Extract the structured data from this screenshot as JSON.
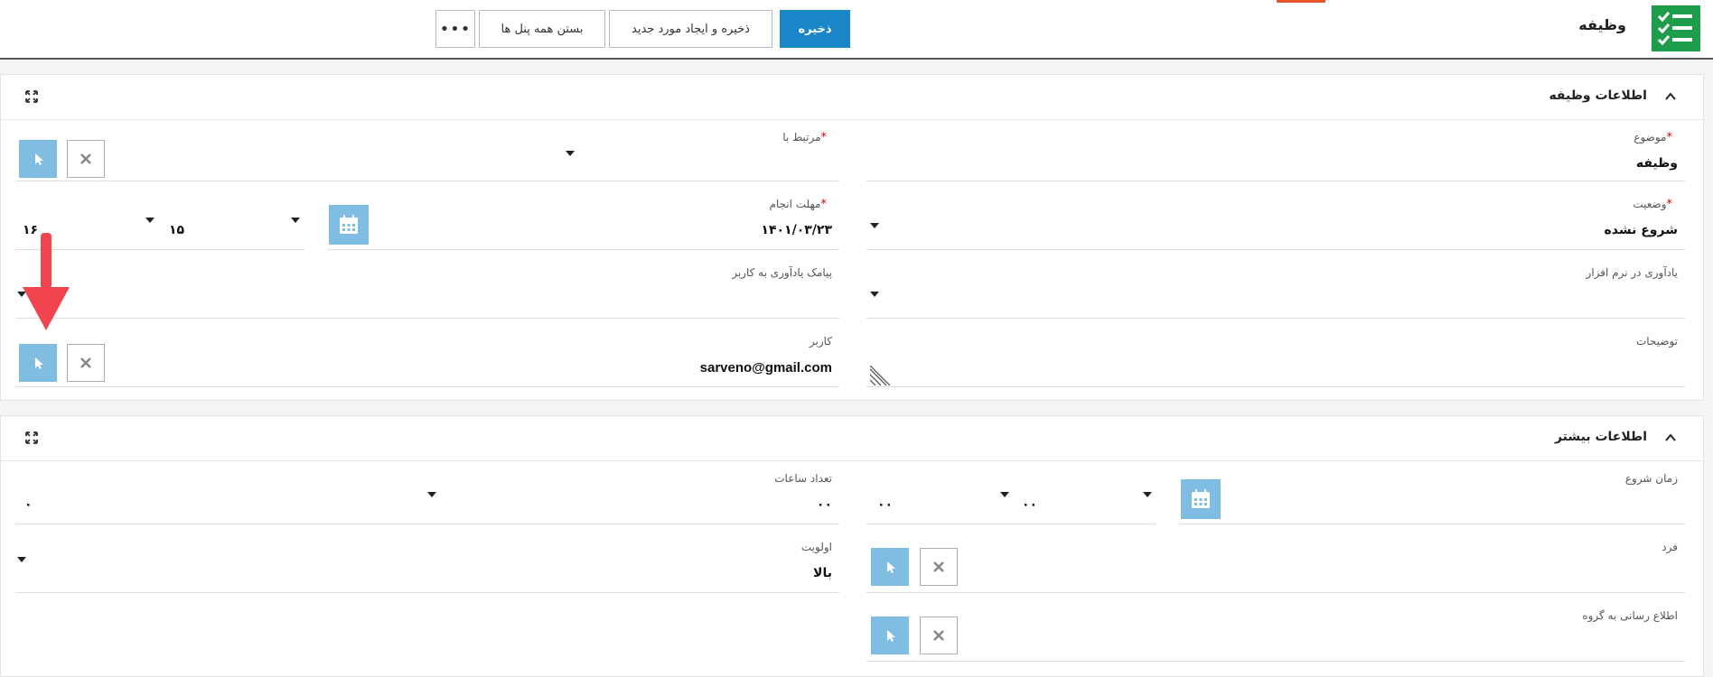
{
  "header": {
    "title": "وظیفه",
    "save_label": "ذخیره",
    "save_new_label": "ذخیره و ایجاد مورد جدید",
    "close_panels_label": "بستن همه پنل ها",
    "more_label": "•••"
  },
  "colors": {
    "primary": "#1a86c8",
    "app_icon": "#1e9e4a",
    "button_light": "#7fbde2",
    "required": "#dd0000",
    "accent": "#e8562a",
    "arrow": "#f0454f"
  },
  "panel1": {
    "title": "اطلاعات وظیفه",
    "subject": {
      "label": "موضوع",
      "value": "وظیفه"
    },
    "related_to": {
      "label": "مرتبط با"
    },
    "status": {
      "label": "وضعیت",
      "value": "شروع نشده"
    },
    "deadline": {
      "label": "مهلت انجام",
      "date": "۱۴۰۱/۰۳/۲۳",
      "hour": "۱۵",
      "minute": "۱۶"
    },
    "reminder_app": {
      "label": "یادآوری در نرم افزار"
    },
    "reminder_sms": {
      "label": "پیامک یادآوری به کاربر"
    },
    "description": {
      "label": "توضیحات"
    },
    "user": {
      "label": "کاربر",
      "value": "sarveno@gmail.com"
    },
    "required_mark": "*"
  },
  "panel2": {
    "title": "اطلاعات بیشتر",
    "start_time": {
      "label": "زمان شروع",
      "hour": "۰۰",
      "minute": "۰۰"
    },
    "hours_count": {
      "label": "تعداد ساعات",
      "hours": "۰۰",
      "minutes": "۰"
    },
    "person": {
      "label": "فرد"
    },
    "priority": {
      "label": "اولویت",
      "value": "بالا"
    },
    "notify_group": {
      "label": "اطلاع رسانی به گروه"
    }
  }
}
